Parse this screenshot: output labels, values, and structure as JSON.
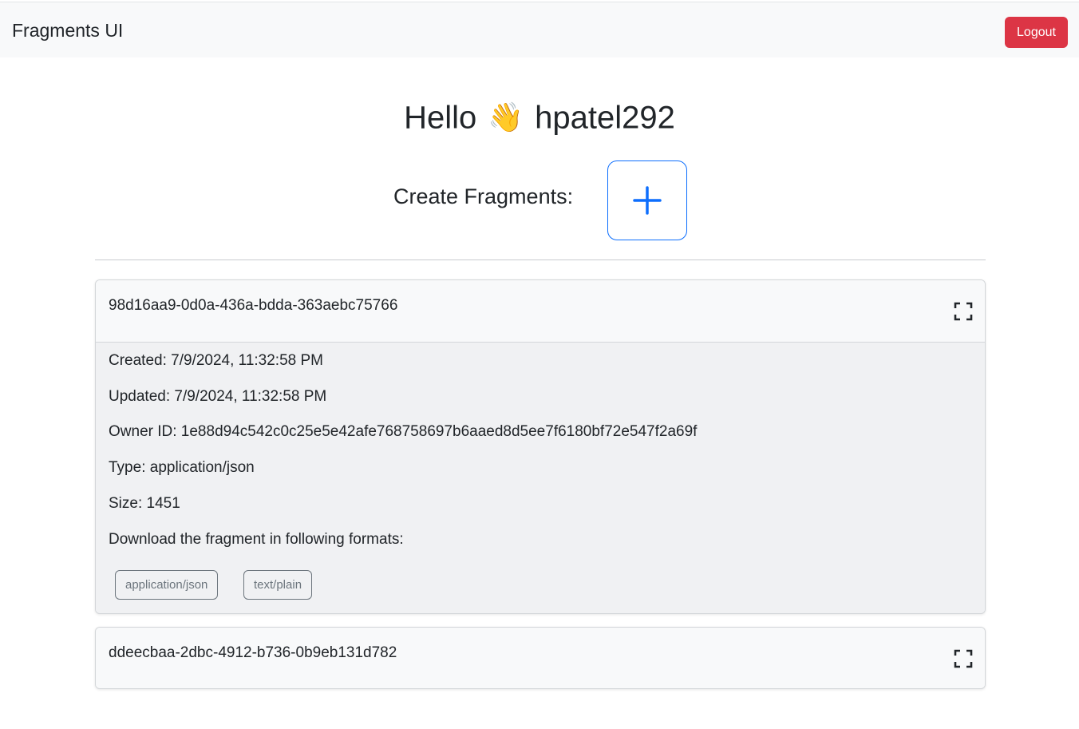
{
  "navbar": {
    "brand": "Fragments UI",
    "logout_label": "Logout",
    "logout_color": "#dc3545"
  },
  "greeting": {
    "hello": "Hello",
    "emoji": "👋",
    "username": "hpatel292"
  },
  "create": {
    "label": "Create Fragments:",
    "icon": "plus-icon",
    "accent": "#0d6efd"
  },
  "fragments": [
    {
      "id": "98d16aa9-0d0a-436a-bdda-363aebc75766",
      "expanded": true,
      "created": "Created: 7/9/2024, 11:32:58 PM",
      "updated": "Updated: 7/9/2024, 11:32:58 PM",
      "owner": "Owner ID: 1e88d94c542c0c25e5e42afe768758697b6aaed8d5ee7f6180bf72e547f2a69f",
      "type": "Type: application/json",
      "size": "Size: 1451",
      "download_label": "Download the fragment in following formats:",
      "formats": [
        "application/json",
        "text/plain"
      ]
    },
    {
      "id": "ddeecbaa-2dbc-4912-b736-0b9eb131d782",
      "expanded": false
    }
  ]
}
